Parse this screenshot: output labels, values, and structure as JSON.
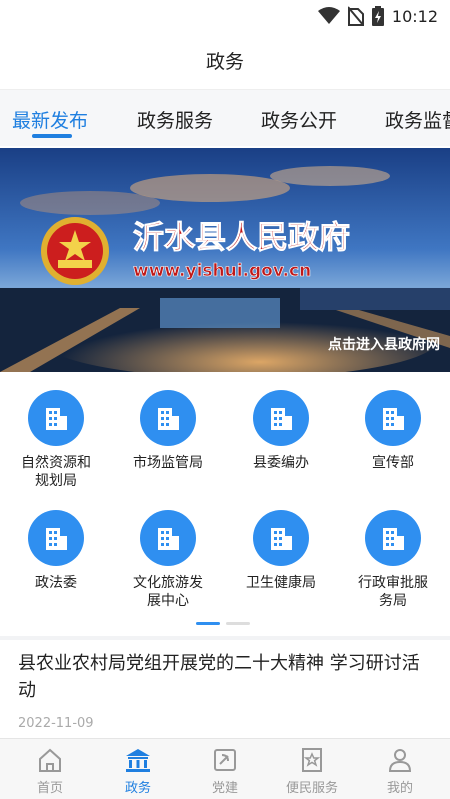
{
  "status": {
    "time": "10:12"
  },
  "header": {
    "title": "政务"
  },
  "tabs": [
    {
      "label": "最新发布",
      "active": true
    },
    {
      "label": "政务服务",
      "active": false
    },
    {
      "label": "政务公开",
      "active": false
    },
    {
      "label": "政务监督",
      "active": false
    }
  ],
  "banner": {
    "title": "沂水县人民政府",
    "url": "www.yishui.gov.cn",
    "link_text": "点击进入县政府网"
  },
  "services": [
    {
      "label": "自然资源和规划局"
    },
    {
      "label": "市场监管局"
    },
    {
      "label": "县委编办"
    },
    {
      "label": "宣传部"
    },
    {
      "label": "政法委"
    },
    {
      "label": "文化旅游发展中心"
    },
    {
      "label": "卫生健康局"
    },
    {
      "label": "行政审批服务局"
    }
  ],
  "pager": {
    "pages": 2,
    "current": 1
  },
  "news": {
    "title": "县农业农村局党组开展党的二十大精神  学习研讨活动",
    "date": "2022-11-09"
  },
  "bottom_nav": [
    {
      "label": "首页",
      "icon": "home-icon",
      "active": false
    },
    {
      "label": "政务",
      "icon": "government-icon",
      "active": true
    },
    {
      "label": "党建",
      "icon": "party-icon",
      "active": false
    },
    {
      "label": "便民服务",
      "icon": "service-star-icon",
      "active": false
    },
    {
      "label": "我的",
      "icon": "user-icon",
      "active": false
    }
  ],
  "colors": {
    "accent": "#1f7fe0",
    "icon_bg": "#2f8ff0"
  }
}
